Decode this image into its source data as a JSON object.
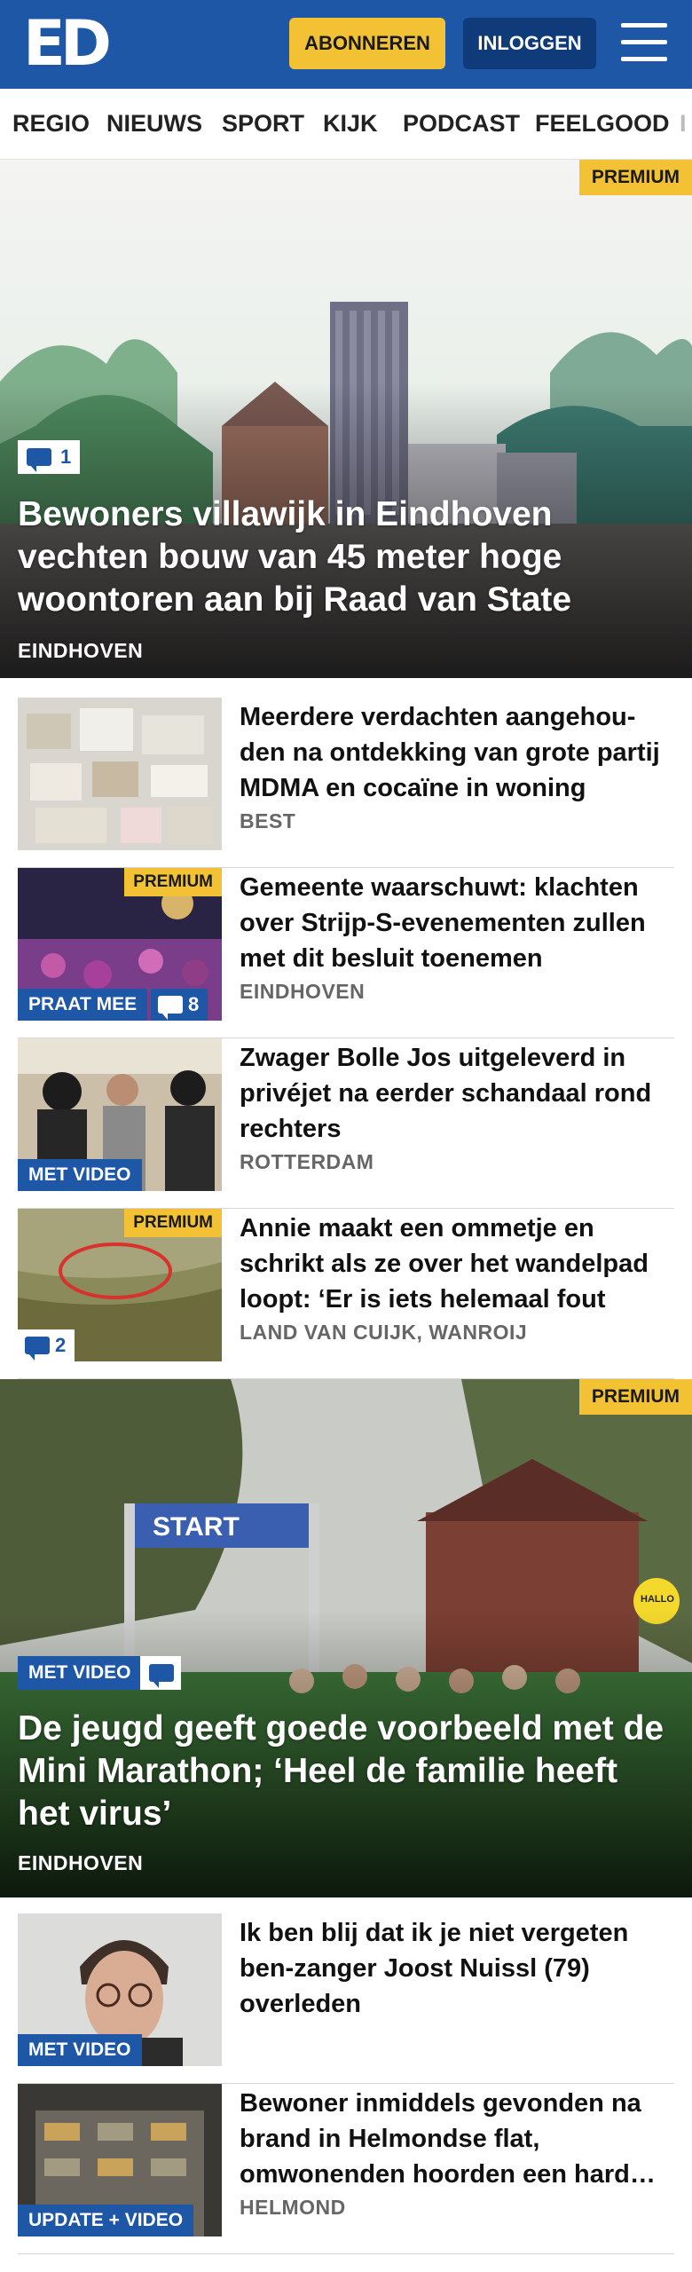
{
  "header": {
    "logo": "ED",
    "subscribe_label": "ABONNEREN",
    "login_label": "INLOGGEN"
  },
  "nav": {
    "items": [
      {
        "label": "REGIO"
      },
      {
        "label": "NIEUWS"
      },
      {
        "label": "SPORT"
      },
      {
        "label": "KIJK"
      },
      {
        "label": "PODCAST"
      },
      {
        "label": "FEELGOOD"
      },
      {
        "label": "I"
      }
    ]
  },
  "hero1": {
    "premium": "PREMIUM",
    "comments": "1",
    "title": "Bewoners villawijk in Eindhoven vechten bouw van 45 meter hoge woontoren aan bij Raad van State",
    "location": "EINDHOVEN"
  },
  "articles": [
    {
      "title": "Meerdere verdachten aangehou­den na ontdekking van grote partij MDMA en cocaïne in woning",
      "location": "BEST"
    },
    {
      "premium": "PREMIUM",
      "badge": "PRAAT MEE",
      "comments": "8",
      "title": "Gemeente waarschuwt: klachten over Strijp-S-evenementen zullen met dit besluit toenemen",
      "location": "EINDHOVEN"
    },
    {
      "badge": "MET VIDEO",
      "title": "Zwager Bolle Jos uitgeleverd in privéjet na eerder schandaal rond rechters",
      "location": "ROTTERDAM"
    },
    {
      "premium": "PREMIUM",
      "comments": "2",
      "title": "Annie maakt een ommetje en schrikt als ze over het wandelpad loopt: ‘Er is iets helemaal fout",
      "location": "LAND VAN CUIJK, WANROIJ"
    }
  ],
  "hero2": {
    "premium": "PREMIUM",
    "badge": "MET VIDEO",
    "banner_text": "START",
    "balloon_text": "HALLO",
    "title": "De jeugd geeft goede voorbeeld met de Mini Marathon; ‘Heel de familie heeft het virus’",
    "location": "EINDHOVEN"
  },
  "articles2": [
    {
      "badge": "MET VIDEO",
      "title": "Ik ben blij dat ik je niet vergeten ben-zanger Joost Nuissl (79) overleden",
      "location": ""
    },
    {
      "badge": "UPDATE + VIDEO",
      "title": "Bewoner inmiddels gevonden na brand in Helmondse flat, omwonenden hoorden een harde knal",
      "location": "HELMOND"
    }
  ],
  "colors": {
    "brand_blue": "#1e57a6",
    "dark_blue": "#0f3b7a",
    "premium_yellow": "#f3c234"
  }
}
